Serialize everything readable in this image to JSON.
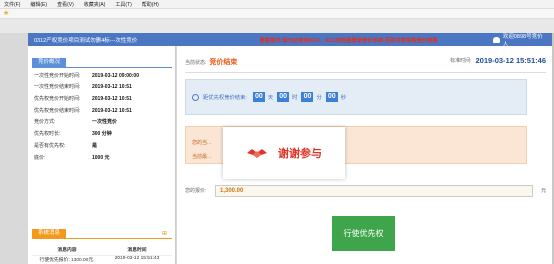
{
  "menu": [
    "文件(F)",
    "编辑(E)",
    "查看(V)",
    "收藏夹(A)",
    "工具(T)",
    "帮助(H)"
  ],
  "header": {
    "project_title": "0312产权竞价项目测试勿删4标---次性竞价",
    "notice": "重要提示:请勿必使用IE10、IE11浏览器登录竞价系统,否则可能导致竞价结果",
    "welcome": "欢迎0898号竞价人"
  },
  "left": {
    "overview_title": "竞价概况",
    "rows": [
      {
        "k": "一次性竞价开始时间:",
        "v": "2019-03-12 09:00:00"
      },
      {
        "k": "一次性竞价结束时间:",
        "v": "2019-03-12 10:51"
      },
      {
        "k": "优先权竞价开始时间:",
        "v": "2019-03-12 10:51"
      },
      {
        "k": "优先权竞价结束时间:",
        "v": "2019-03-12 10:51"
      },
      {
        "k": "竞价方式:",
        "v": "一次性竞价"
      },
      {
        "k": "优先权时长:",
        "v": "300 分钟"
      },
      {
        "k": "是否有优先权:",
        "v": "是"
      },
      {
        "k": "底价:",
        "v": "1000 元"
      }
    ],
    "messages_title": "系统消息",
    "messages_more": "⊞",
    "messages_headers": [
      "消息内容",
      "消息时间"
    ],
    "messages": [
      {
        "content": "行使优先报价: 1300.00元.",
        "time": "2019-03-12 15:51:43"
      }
    ]
  },
  "right": {
    "status_label": "当前状态:",
    "status_value": "竞价结束",
    "time_label": "标准时间:",
    "time_value": "2019-03-12 15:51:46",
    "countdown_label": "距优先权竞价结束:",
    "countdown": {
      "days": "00",
      "hours": "00",
      "minutes": "00",
      "seconds": "00"
    },
    "units": {
      "day": "天",
      "hour": "时",
      "minute": "分",
      "second": "秒"
    },
    "alert1": "您的当...",
    "alert2": "当前最...",
    "price_label": "您的报价:",
    "price_value": "1,300.00",
    "price_unit": "元",
    "exercise_button": "行使优先权"
  },
  "overlay": {
    "text": "谢谢参与"
  },
  "colors": {
    "header": "#4b76c2",
    "status": "#e85a16",
    "countdown_box": "#3d7fd9",
    "button": "#3fa54a",
    "overlay_text": "#e03528"
  }
}
